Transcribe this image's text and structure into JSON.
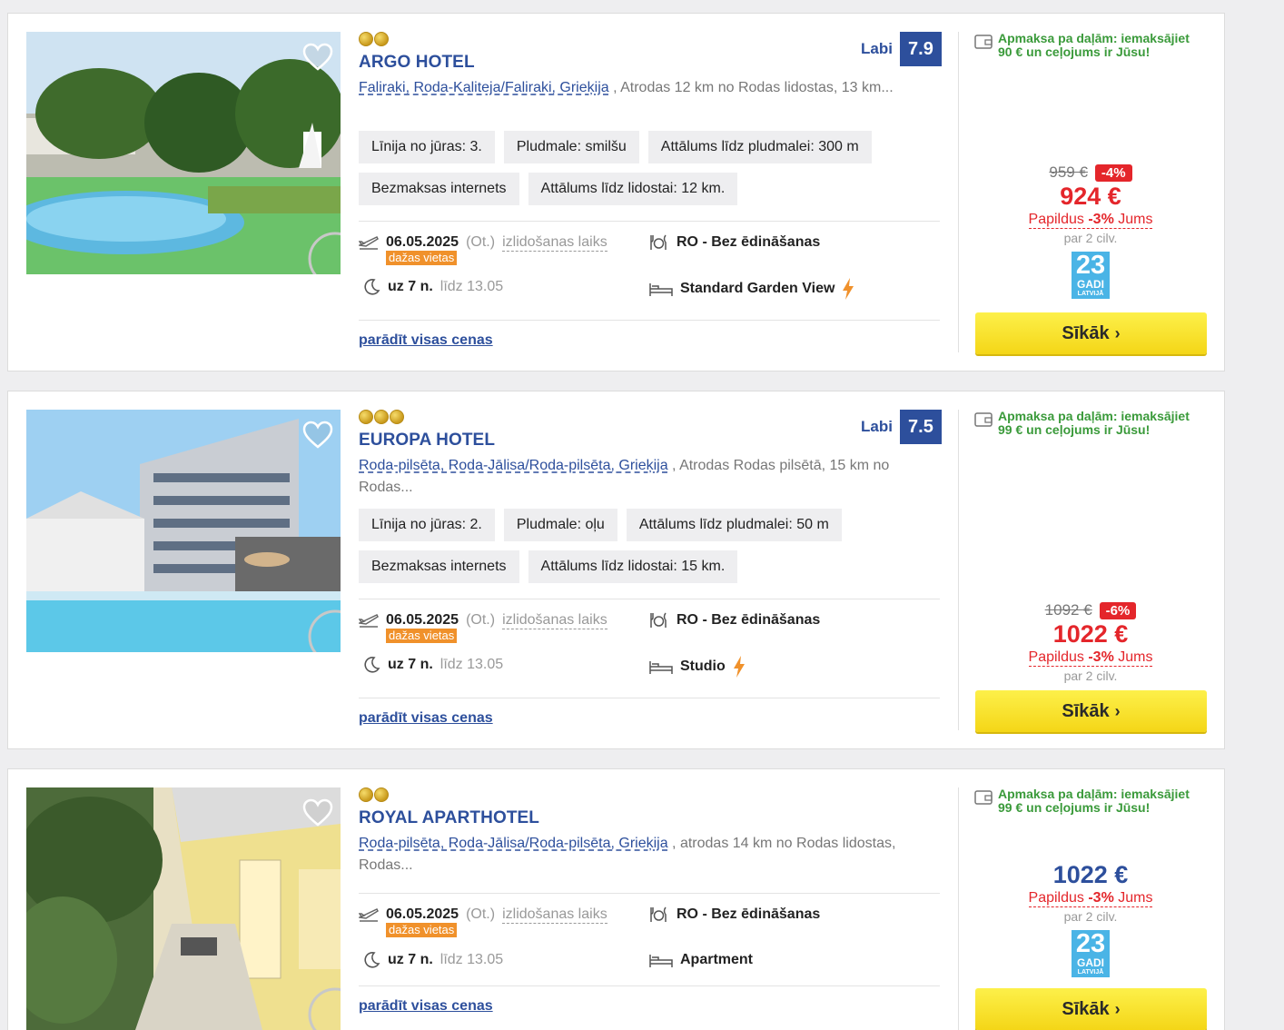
{
  "hotels": [
    {
      "stars": 2,
      "name": "ARGO HOTEL",
      "rating_word": "Labi",
      "rating": "7.9",
      "location_link": "Faliraki, Roda-Kaliteja/Faliraki, Grieķija",
      "location_rest": " , Atrodas 12 km no Rodas lidostas, 13 km...",
      "tags": [
        "Līnija no jūras: 3.",
        "Pludmale: smilšu",
        "Attālums līdz pludmalei: 300 m",
        "Bezmaksas internets",
        "Attālums līdz lidostai: 12 km."
      ],
      "date": "06.05.2025",
      "weekday": "(Ot.)",
      "departure_label": "izlidošanas laiks",
      "few_places": "dažas vietas",
      "nights": "uz 7 n.",
      "until": "līdz 13.05",
      "board": "RO - Bez ēdināšanas",
      "room": "Standard Garden View",
      "room_flash": true,
      "show_all": "parādīt visas cenas",
      "pay_note": "Apmaksa pa daļām: iemaksājiet 90 € un ceļojums ir Jūsu!",
      "old_price": "959 €",
      "discount": "-4%",
      "price": "924 €",
      "extra_prefix": "Papildus ",
      "extra_pct": "-3%",
      "extra_suffix": " Jums",
      "per": "par 2 cilv.",
      "badge": {
        "number": "23",
        "word": "GADI",
        "country": "LATVIJĀ"
      },
      "button": "Sīkāk"
    },
    {
      "stars": 3,
      "name": "EUROPA HOTEL",
      "rating_word": "Labi",
      "rating": "7.5",
      "location_link": "Roda-pilsēta, Roda-Jālisa/Roda-pilsēta, Grieķija",
      "location_rest": " , Atrodas Rodas pilsētā, 15 km no Rodas...",
      "tags": [
        "Līnija no jūras: 2.",
        "Pludmale: oļu",
        "Attālums līdz pludmalei: 50 m",
        "Bezmaksas internets",
        "Attālums līdz lidostai: 15 km."
      ],
      "date": "06.05.2025",
      "weekday": "(Ot.)",
      "departure_label": "izlidošanas laiks",
      "few_places": "dažas vietas",
      "nights": "uz 7 n.",
      "until": "līdz 13.05",
      "board": "RO - Bez ēdināšanas",
      "room": "Studio",
      "room_flash": true,
      "show_all": "parādīt visas cenas",
      "pay_note": "Apmaksa pa daļām: iemaksājiet 99 € un ceļojums ir Jūsu!",
      "old_price": "1092 €",
      "discount": "-6%",
      "price": "1022 €",
      "extra_prefix": "Papildus ",
      "extra_pct": "-3%",
      "extra_suffix": " Jums",
      "per": "par 2 cilv.",
      "button": "Sīkāk"
    },
    {
      "stars": 2,
      "name": "ROYAL APARTHOTEL",
      "location_link": "Roda-pilsēta, Roda-Jālisa/Roda-pilsēta, Grieķija",
      "location_rest": " , atrodas 14 km no Rodas lidostas, Rodas...",
      "tags": [],
      "date": "06.05.2025",
      "weekday": "(Ot.)",
      "departure_label": "izlidošanas laiks",
      "few_places": "dažas vietas",
      "nights": "uz 7 n.",
      "until": "līdz 13.05",
      "board": "RO - Bez ēdināšanas",
      "room": "Apartment",
      "room_flash": false,
      "show_all": "parādīt visas cenas",
      "pay_note": "Apmaksa pa daļām: iemaksājiet 99 € un ceļojums ir Jūsu!",
      "price": "1022 €",
      "extra_prefix": "Papildus ",
      "extra_pct": "-3%",
      "extra_suffix": " Jums",
      "per": "par 2 cilv.",
      "badge": {
        "number": "23",
        "word": "GADI",
        "country": "LATVIJĀ"
      },
      "button": "Sīkāk"
    }
  ],
  "colors": {
    "brand_blue": "#2d4f9c",
    "price_red": "#e4262b",
    "pay_green": "#3a9a3a",
    "few_orange": "#f0912b",
    "button_yellow": "#f7df2a",
    "badge_blue": "#4ab4e6"
  }
}
